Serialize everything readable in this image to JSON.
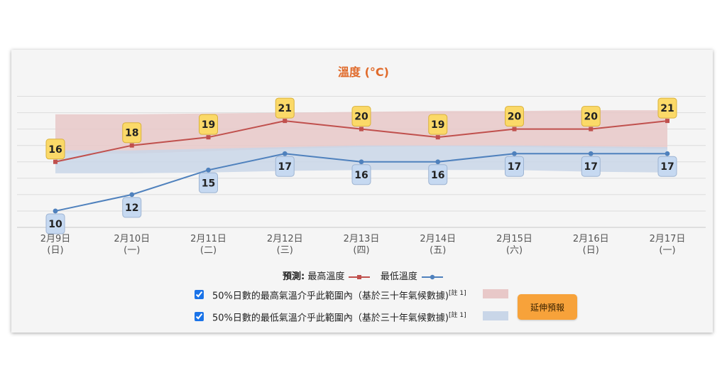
{
  "chart_data": {
    "type": "line",
    "title": "溫度 (°C)",
    "categories": [
      "2月9日",
      "2月10日",
      "2月11日",
      "2月12日",
      "2月13日",
      "2月14日",
      "2月15日",
      "2月16日",
      "2月17日"
    ],
    "weekdays": [
      "(日)",
      "(一)",
      "(二)",
      "(三)",
      "(四)",
      "(五)",
      "(六)",
      "(日)",
      "(一)"
    ],
    "series": [
      {
        "name": "最高溫度",
        "values": [
          16,
          18,
          19,
          21,
          20,
          19,
          20,
          20,
          21
        ],
        "color": "#c0504d",
        "label_bg": "#fbd968"
      },
      {
        "name": "最低溫度",
        "values": [
          10,
          12,
          15,
          17,
          16,
          16,
          17,
          17,
          17
        ],
        "color": "#4f81bd",
        "label_bg": "#c6d9f1"
      }
    ],
    "bands": [
      {
        "name": "50%日數的最高氣溫介乎此範圍內",
        "lower": [
          17,
          17,
          17.3,
          17.6,
          17.8,
          17.9,
          17.8,
          17.7,
          17.6
        ],
        "upper": [
          21.8,
          21.8,
          21.9,
          22,
          22.1,
          22.2,
          22.2,
          22.3,
          22.3
        ],
        "color": "#e8c8c8"
      },
      {
        "name": "50%日數的最低氣溫介乎此範圍內",
        "lower": [
          14.6,
          14.6,
          14.7,
          14.9,
          15,
          15,
          15,
          14.8,
          14.7
        ],
        "upper": [
          17.4,
          17.4,
          17.6,
          17.8,
          18,
          18,
          18,
          17.9,
          17.8
        ],
        "color": "#c9d6e8"
      }
    ],
    "ylim": [
      8,
      25
    ],
    "grid": true
  },
  "legend": {
    "prefix": "預測:",
    "max_label": "最高溫度",
    "min_label": "最低溫度"
  },
  "ranges": {
    "max_text": "50%日數的最高氣溫介乎此範圍內（基於三十年氣候數據)",
    "min_text": "50%日數的最低氣溫介乎此範圍內（基於三十年氣候數據)",
    "note": "[註 1]",
    "max_checked": true,
    "min_checked": true
  },
  "button": {
    "label": "延伸預報"
  }
}
